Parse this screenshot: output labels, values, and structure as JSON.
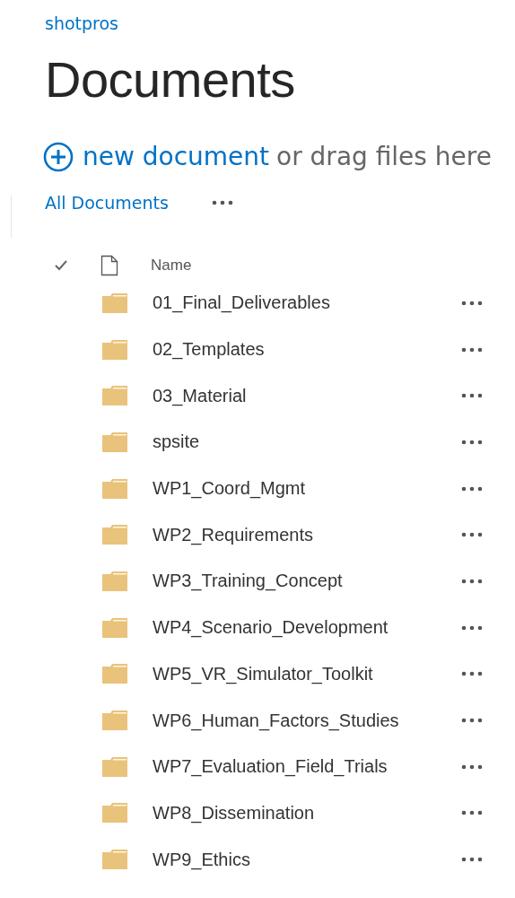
{
  "site": {
    "title": "shotpros"
  },
  "page": {
    "title": "Documents"
  },
  "upload": {
    "action": "new document",
    "hint": "or drag files here"
  },
  "views": [
    {
      "label": "All Documents",
      "selected": true
    }
  ],
  "table": {
    "columns": [
      {
        "label": "Name"
      }
    ],
    "rows": [
      {
        "name": "01_Final_Deliverables"
      },
      {
        "name": "02_Templates"
      },
      {
        "name": "03_Material"
      },
      {
        "name": "spsite"
      },
      {
        "name": "WP1_Coord_Mgmt"
      },
      {
        "name": "WP2_Requirements"
      },
      {
        "name": "WP3_Training_Concept"
      },
      {
        "name": "WP4_Scenario_Development"
      },
      {
        "name": "WP5_VR_Simulator_Toolkit"
      },
      {
        "name": "WP6_Human_Factors_Studies"
      },
      {
        "name": "WP7_Evaluation_Field_Trials"
      },
      {
        "name": "WP8_Dissemination"
      },
      {
        "name": "WP9_Ethics"
      }
    ]
  }
}
